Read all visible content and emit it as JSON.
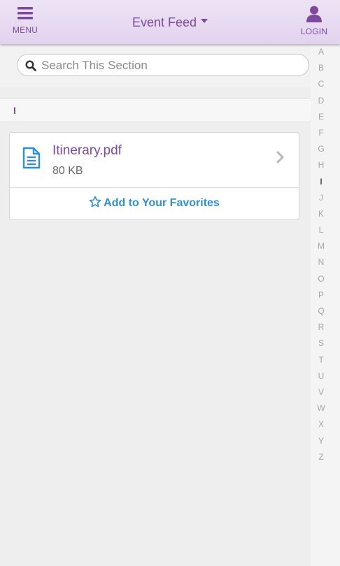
{
  "header": {
    "menu_label": "MENU",
    "title": "Event Feed",
    "login_label": "LOGIN",
    "menu_icon": "hamburger-icon",
    "login_icon": "user-icon",
    "accent": "#7d4a9e"
  },
  "search": {
    "placeholder": "Search This Section",
    "value": ""
  },
  "section": {
    "letter": "I"
  },
  "file": {
    "name": "Itinerary.pdf",
    "size": "80 KB",
    "icon": "document-icon",
    "favorite_label": "Add to Your Favorites",
    "favorite_color": "#2f8fd4"
  },
  "alphabet": {
    "letters": [
      "A",
      "B",
      "C",
      "D",
      "E",
      "F",
      "G",
      "H",
      "I",
      "J",
      "K",
      "L",
      "M",
      "N",
      "O",
      "P",
      "Q",
      "R",
      "S",
      "T",
      "U",
      "V",
      "W",
      "X",
      "Y",
      "Z"
    ],
    "active": "I"
  }
}
